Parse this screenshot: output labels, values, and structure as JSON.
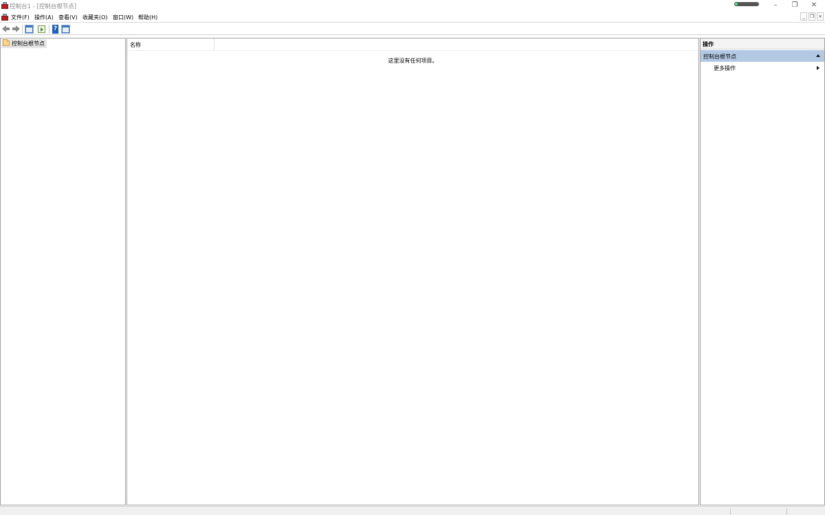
{
  "window": {
    "title": "控制台1 - [控制台根节点]",
    "minimize_glyph": "–",
    "restore_glyph": "❐",
    "close_glyph": "✕"
  },
  "menubar": {
    "items": [
      {
        "label": "文件(F)"
      },
      {
        "label": "操作(A)"
      },
      {
        "label": "查看(V)"
      },
      {
        "label": "收藏夹(O)"
      },
      {
        "label": "窗口(W)"
      },
      {
        "label": "帮助(H)"
      }
    ],
    "mdi": {
      "minimize": "_",
      "restore": "❐",
      "close": "×"
    }
  },
  "toolbar": {
    "icons": [
      "back-icon",
      "forward-icon",
      "show-hide-console-tree-icon",
      "export-list-icon",
      "help-icon",
      "show-hide-action-pane-icon"
    ],
    "help_glyph": "?"
  },
  "tree": {
    "root_label": "控制台根节点"
  },
  "center": {
    "column_name": "名称",
    "empty_message": "这里没有任何项目。"
  },
  "actions": {
    "title": "操作",
    "group_label": "控制台根节点",
    "more_actions": "更多操作"
  },
  "colors": {
    "accent_selected": "#b3c9e3",
    "tree_selected": "#e5e5e5",
    "app_icon_red": "#b91c1c"
  }
}
